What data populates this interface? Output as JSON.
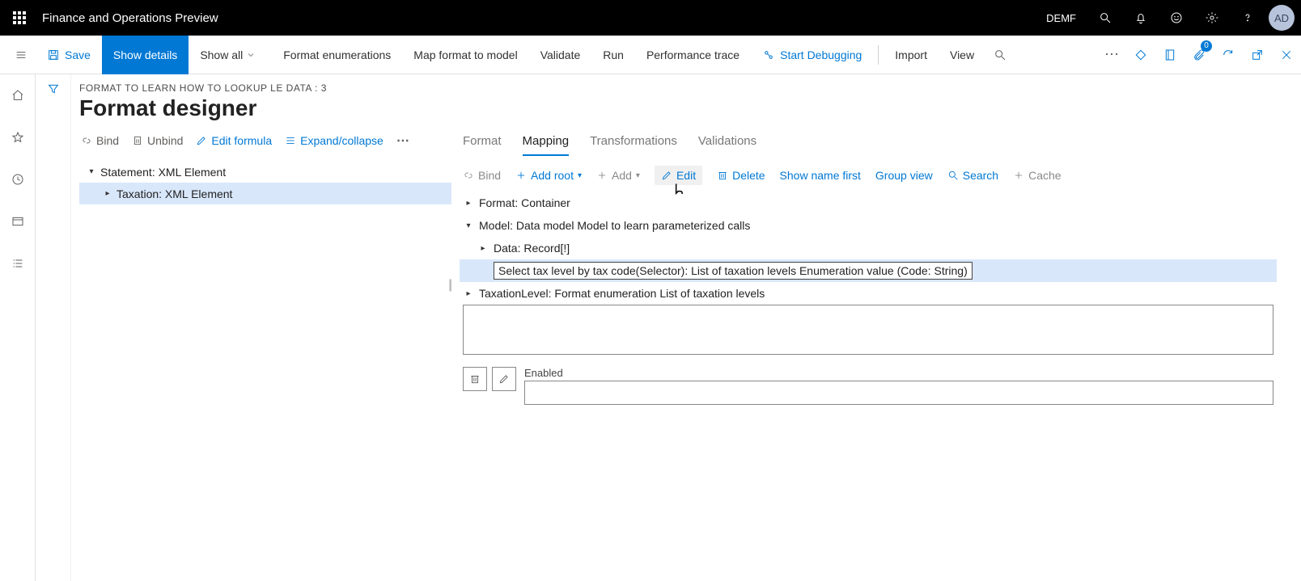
{
  "top": {
    "app_title": "Finance and Operations Preview",
    "company": "DEMF",
    "avatar": "AD",
    "docs_badge": "0"
  },
  "cmdbar": {
    "save": "Save",
    "show_details": "Show details",
    "show_all": "Show all",
    "format_enum": "Format enumerations",
    "map_format": "Map format to model",
    "validate": "Validate",
    "run": "Run",
    "perf_trace": "Performance trace",
    "start_debug": "Start Debugging",
    "import": "Import",
    "view": "View"
  },
  "page": {
    "breadcrumb": "FORMAT TO LEARN HOW TO LOOKUP LE DATA : 3",
    "title": "Format designer"
  },
  "left_toolbar": {
    "bind": "Bind",
    "unbind": "Unbind",
    "edit_formula": "Edit formula",
    "expand_collapse": "Expand/collapse"
  },
  "left_tree": {
    "node0": "Statement: XML Element",
    "node1": "Taxation: XML Element"
  },
  "tabs": {
    "format": "Format",
    "mapping": "Mapping",
    "transformations": "Transformations",
    "validations": "Validations"
  },
  "right_toolbar": {
    "bind": "Bind",
    "add_root": "Add root",
    "add": "Add",
    "edit": "Edit",
    "delete": "Delete",
    "show_name_first": "Show name first",
    "group_view": "Group view",
    "search": "Search",
    "cache": "Cache"
  },
  "right_tree": {
    "n0": "Format: Container",
    "n1": "Model: Data model Model to learn parameterized calls",
    "n2": "Data: Record[!]",
    "n3": "Select tax level by tax code(Selector): List of taxation levels Enumeration value (Code: String)",
    "n4": "TaxationLevel: Format enumeration List of taxation levels"
  },
  "bottom": {
    "enabled_label": "Enabled"
  }
}
